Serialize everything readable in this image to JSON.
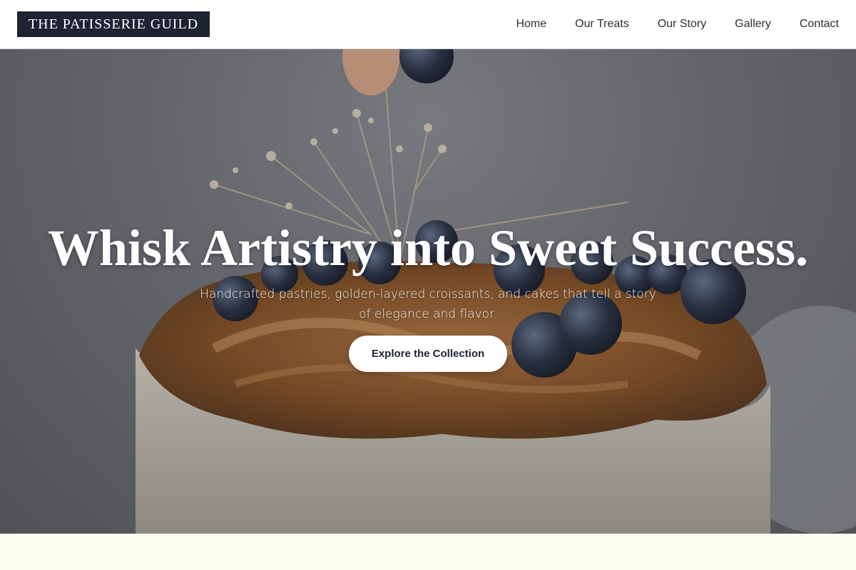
{
  "header": {
    "logo_text": "THE PATISSERIE GUILD",
    "nav": [
      {
        "label": "Home"
      },
      {
        "label": "Our Treats"
      },
      {
        "label": "Our Story"
      },
      {
        "label": "Gallery"
      },
      {
        "label": "Contact"
      }
    ]
  },
  "hero": {
    "title": "Whisk Artistry into Sweet Success.",
    "subtitle": "Handcrafted pastries, golden-layered croissants, and cakes that tell a story of elegance and flavor.",
    "cta_label": "Explore the Collection",
    "image_subject": "cake-with-blueberries-and-dried-flowers"
  },
  "colors": {
    "logo_bg": "#1d2331",
    "page_bg": "#fefef0",
    "cta_bg": "#ffffff",
    "cta_text": "#1d2331"
  }
}
